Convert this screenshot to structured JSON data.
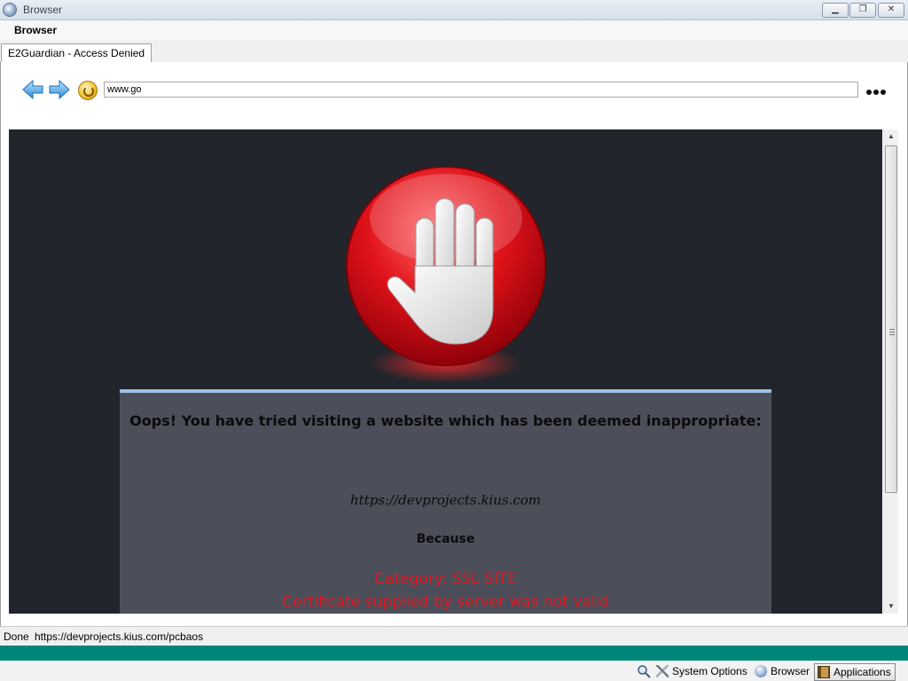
{
  "window": {
    "title": "Browser",
    "minimize_glyph": "▁",
    "restore_glyph": "❐",
    "close_glyph": "✕"
  },
  "app": {
    "label": "Browser"
  },
  "tabs": [
    {
      "label": "E2Guardian - Access Denied",
      "active": true
    }
  ],
  "nav": {
    "url": "www.go",
    "more_icon": "ellipsis-icon"
  },
  "page": {
    "heading": "Oops! You have tried visiting a website which has been deemed inappropriate:",
    "blocked_url": "https://devprojects.kius.com",
    "because_label": "Because",
    "category": "Category: SSL SITE",
    "reason": "Certificate supplied by server was not valid",
    "colors": {
      "background": "#22252b",
      "box": "#4c4f5a",
      "accent": "#9cc3e8",
      "alert": "#e3141c"
    }
  },
  "status": {
    "state": "Done",
    "url": "https://devprojects.kius.com/pcbaos"
  },
  "taskbar": {
    "items": [
      {
        "label": "System Options",
        "icon": "tools-icon"
      },
      {
        "label": "Browser",
        "icon": "globe-icon"
      },
      {
        "label": "Applications",
        "icon": "applications-icon"
      }
    ]
  },
  "theme": {
    "status_strip": "#008779"
  }
}
